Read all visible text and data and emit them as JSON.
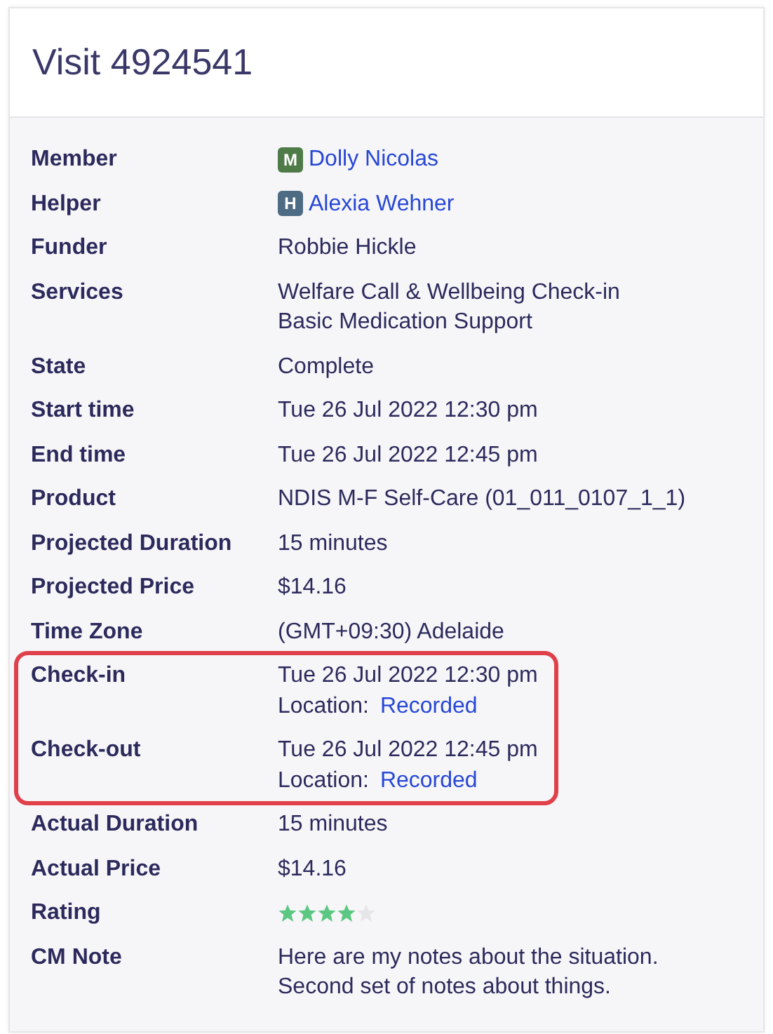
{
  "title": "Visit 4924541",
  "rows": [
    {
      "label": "Member",
      "kind": "person",
      "badge": "M",
      "color": "#4e7b47",
      "value": "Dolly Nicolas",
      "highlighted": false
    },
    {
      "label": "Helper",
      "kind": "person",
      "badge": "H",
      "color": "#4d6c84",
      "value": "Alexia Wehner",
      "highlighted": false
    },
    {
      "label": "Funder",
      "kind": "text",
      "value": "Robbie Hickle",
      "highlighted": false
    },
    {
      "label": "Services",
      "kind": "lines",
      "lines": [
        "Welfare Call & Wellbeing Check-in",
        "Basic Medication Support"
      ],
      "highlighted": false
    },
    {
      "label": "State",
      "kind": "text",
      "value": "Complete",
      "highlighted": false
    },
    {
      "label": "Start time",
      "kind": "text",
      "value": "Tue 26 Jul 2022 12:30 pm",
      "highlighted": false
    },
    {
      "label": "End time",
      "kind": "text",
      "value": "Tue 26 Jul 2022 12:45 pm",
      "highlighted": false
    },
    {
      "label": "Product",
      "kind": "text",
      "value": "NDIS M-F Self-Care (01_011_0107_1_1)",
      "highlighted": false
    },
    {
      "label": "Projected Duration",
      "kind": "text",
      "value": "15 minutes",
      "highlighted": false
    },
    {
      "label": "Projected Price",
      "kind": "text",
      "value": "$14.16",
      "highlighted": false
    },
    {
      "label": "Time Zone",
      "kind": "text",
      "value": "(GMT+09:30) Adelaide",
      "highlighted": false
    },
    {
      "label": "Check-in",
      "kind": "check",
      "value": "Tue 26 Jul 2022 12:30 pm",
      "location_label": "Location:",
      "location": "Recorded",
      "highlighted": true
    },
    {
      "label": "Check-out",
      "kind": "check",
      "value": "Tue 26 Jul 2022 12:45 pm",
      "location_label": "Location:",
      "location": "Recorded",
      "highlighted": true
    },
    {
      "label": "Actual Duration",
      "kind": "text",
      "value": "15 minutes",
      "highlighted": false
    },
    {
      "label": "Actual Price",
      "kind": "text",
      "value": "$14.16",
      "highlighted": false
    },
    {
      "label": "Rating",
      "kind": "rating",
      "stars": 4,
      "highlighted": false
    },
    {
      "label": "CM Note",
      "kind": "lines",
      "lines": [
        "Here are my notes about the situation.",
        "Second set of notes about things."
      ],
      "highlighted": false
    }
  ]
}
